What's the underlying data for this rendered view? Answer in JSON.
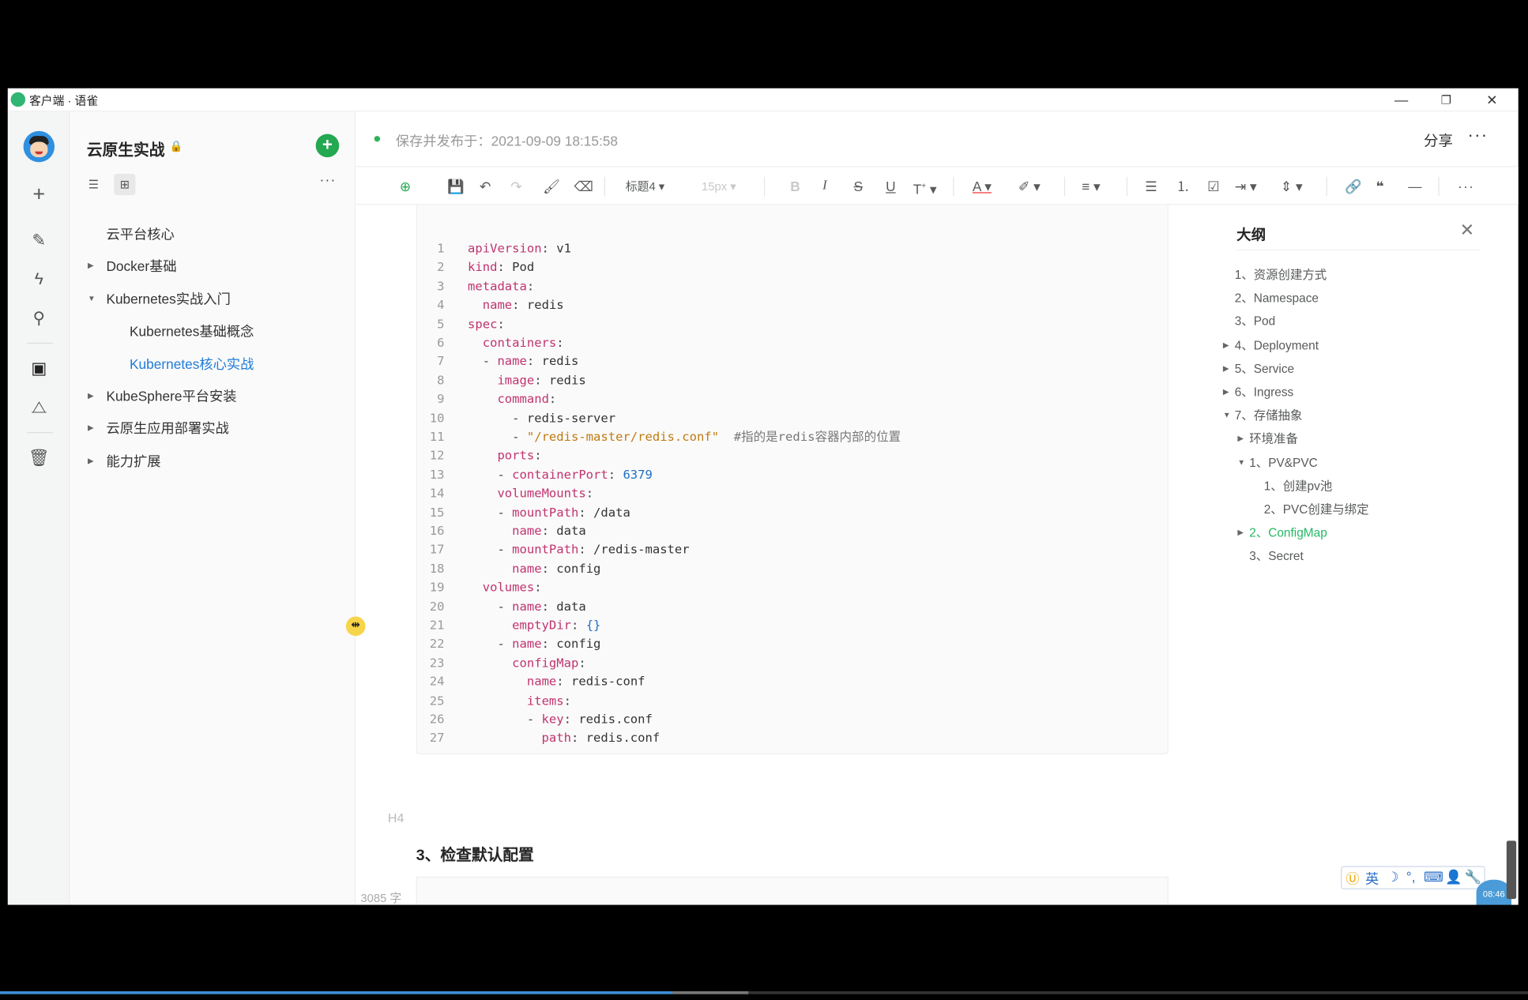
{
  "window": {
    "title": "客户端 · 语雀"
  },
  "sidebar": {
    "book_title": "云原生实战",
    "tree": [
      {
        "label": "云平台核心",
        "level": 0,
        "caret": ""
      },
      {
        "label": "Docker基础",
        "level": 0,
        "caret": "▶"
      },
      {
        "label": "Kubernetes实战入门",
        "level": 0,
        "caret": "▼"
      },
      {
        "label": "Kubernetes基础概念",
        "level": 1,
        "caret": ""
      },
      {
        "label": "Kubernetes核心实战",
        "level": 1,
        "caret": "",
        "active": true
      },
      {
        "label": "KubeSphere平台安装",
        "level": 0,
        "caret": "▶"
      },
      {
        "label": "云原生应用部署实战",
        "level": 0,
        "caret": "▶"
      },
      {
        "label": "能力扩展",
        "level": 0,
        "caret": "▶"
      }
    ]
  },
  "editor": {
    "save_status": "保存并发布于：2021-09-09 18:15:58",
    "share_label": "分享",
    "toolbar": {
      "heading_select": "标题4",
      "font_size_select": "15px"
    },
    "code_lines": [
      [
        [
          "k",
          "apiVersion"
        ],
        [
          "p",
          ": "
        ],
        [
          "v",
          "v1"
        ]
      ],
      [
        [
          "k",
          "kind"
        ],
        [
          "p",
          ": "
        ],
        [
          "v",
          "Pod"
        ]
      ],
      [
        [
          "k",
          "metadata"
        ],
        [
          "p",
          ":"
        ]
      ],
      [
        [
          "p",
          "  "
        ],
        [
          "k",
          "name"
        ],
        [
          "p",
          ": "
        ],
        [
          "v",
          "redis"
        ]
      ],
      [
        [
          "k",
          "spec"
        ],
        [
          "p",
          ":"
        ]
      ],
      [
        [
          "p",
          "  "
        ],
        [
          "k",
          "containers"
        ],
        [
          "p",
          ":"
        ]
      ],
      [
        [
          "p",
          "  - "
        ],
        [
          "k",
          "name"
        ],
        [
          "p",
          ": "
        ],
        [
          "v",
          "redis"
        ]
      ],
      [
        [
          "p",
          "    "
        ],
        [
          "k",
          "image"
        ],
        [
          "p",
          ": "
        ],
        [
          "v",
          "redis"
        ]
      ],
      [
        [
          "p",
          "    "
        ],
        [
          "k",
          "command"
        ],
        [
          "p",
          ":"
        ]
      ],
      [
        [
          "p",
          "      - "
        ],
        [
          "v",
          "redis-server"
        ]
      ],
      [
        [
          "p",
          "      - "
        ],
        [
          "s",
          "\"/redis-master/redis.conf\""
        ],
        [
          "p",
          "  "
        ],
        [
          "c",
          "#指的是redis容器内部的位置"
        ]
      ],
      [
        [
          "p",
          "    "
        ],
        [
          "k",
          "ports"
        ],
        [
          "p",
          ":"
        ]
      ],
      [
        [
          "p",
          "    - "
        ],
        [
          "k",
          "containerPort"
        ],
        [
          "p",
          ": "
        ],
        [
          "n",
          "6379"
        ]
      ],
      [
        [
          "p",
          "    "
        ],
        [
          "k",
          "volumeMounts"
        ],
        [
          "p",
          ":"
        ]
      ],
      [
        [
          "p",
          "    - "
        ],
        [
          "k",
          "mountPath"
        ],
        [
          "p",
          ": "
        ],
        [
          "v",
          "/data"
        ]
      ],
      [
        [
          "p",
          "      "
        ],
        [
          "k",
          "name"
        ],
        [
          "p",
          ": "
        ],
        [
          "v",
          "data"
        ]
      ],
      [
        [
          "p",
          "    - "
        ],
        [
          "k",
          "mountPath"
        ],
        [
          "p",
          ": "
        ],
        [
          "v",
          "/redis-master"
        ]
      ],
      [
        [
          "p",
          "      "
        ],
        [
          "k",
          "name"
        ],
        [
          "p",
          ": "
        ],
        [
          "v",
          "config"
        ]
      ],
      [
        [
          "p",
          "  "
        ],
        [
          "k",
          "volumes"
        ],
        [
          "p",
          ":"
        ]
      ],
      [
        [
          "p",
          "    - "
        ],
        [
          "k",
          "name"
        ],
        [
          "p",
          ": "
        ],
        [
          "v",
          "data"
        ]
      ],
      [
        [
          "p",
          "      "
        ],
        [
          "k",
          "emptyDir"
        ],
        [
          "p",
          ": "
        ],
        [
          "n",
          "{}"
        ]
      ],
      [
        [
          "p",
          "    - "
        ],
        [
          "k",
          "name"
        ],
        [
          "p",
          ": "
        ],
        [
          "v",
          "config"
        ]
      ],
      [
        [
          "p",
          "      "
        ],
        [
          "k",
          "configMap"
        ],
        [
          "p",
          ":"
        ]
      ],
      [
        [
          "p",
          "        "
        ],
        [
          "k",
          "name"
        ],
        [
          "p",
          ": "
        ],
        [
          "v",
          "redis-conf"
        ]
      ],
      [
        [
          "p",
          "        "
        ],
        [
          "k",
          "items"
        ],
        [
          "p",
          ":"
        ]
      ],
      [
        [
          "p",
          "        - "
        ],
        [
          "k",
          "key"
        ],
        [
          "p",
          ": "
        ],
        [
          "v",
          "redis.conf"
        ]
      ],
      [
        [
          "p",
          "          "
        ],
        [
          "k",
          "path"
        ],
        [
          "p",
          ": "
        ],
        [
          "v",
          "redis.conf"
        ]
      ]
    ],
    "heading_badge": "H4",
    "heading": "3、检查默认配置",
    "word_count": "3085 字"
  },
  "outline": {
    "title": "大纲",
    "items": [
      {
        "label": "1、资源创建方式",
        "level": 0,
        "caret": ""
      },
      {
        "label": "2、Namespace",
        "level": 0,
        "caret": ""
      },
      {
        "label": "3、Pod",
        "level": 0,
        "caret": ""
      },
      {
        "label": "4、Deployment",
        "level": 0,
        "caret": "▶"
      },
      {
        "label": "5、Service",
        "level": 0,
        "caret": "▶"
      },
      {
        "label": "6、Ingress",
        "level": 0,
        "caret": "▶"
      },
      {
        "label": "7、存储抽象",
        "level": 0,
        "caret": "▼"
      },
      {
        "label": "环境准备",
        "level": 1,
        "caret": "▶"
      },
      {
        "label": "1、PV&PVC",
        "level": 1,
        "caret": "▼"
      },
      {
        "label": "1、创建pv池",
        "level": 2,
        "caret": ""
      },
      {
        "label": "2、PVC创建与绑定",
        "level": 2,
        "caret": ""
      },
      {
        "label": "2、ConfigMap",
        "level": 1,
        "caret": "▶",
        "active": true
      },
      {
        "label": "3、Secret",
        "level": 1,
        "caret": ""
      }
    ]
  },
  "taskbar": {
    "ime_lang": "英",
    "clock": "08:46"
  },
  "video_progress": 0.44,
  "video_buffered": 0.49,
  "colors": {
    "accent": "#24a852",
    "link": "#1f7bd8",
    "outline_active": "#25b864"
  }
}
